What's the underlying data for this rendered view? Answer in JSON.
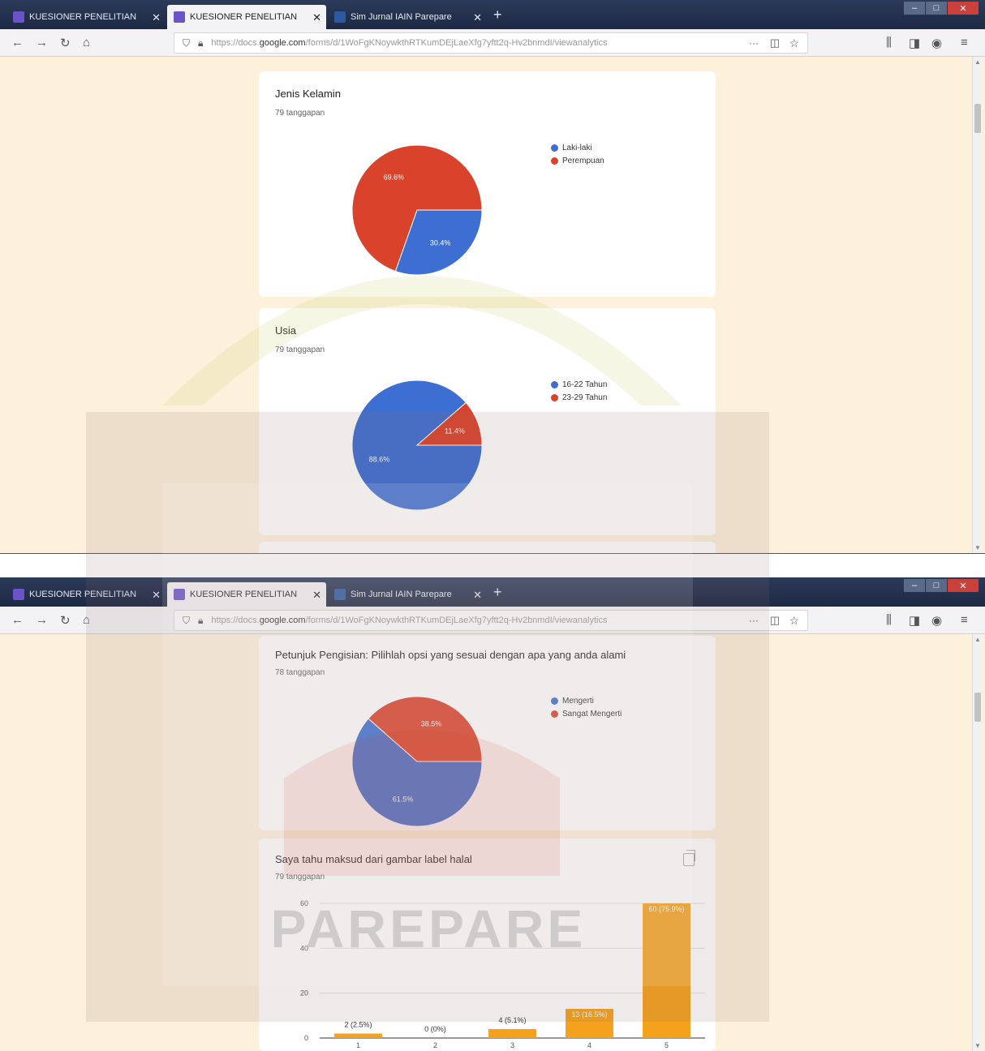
{
  "browser": {
    "tabs": [
      {
        "label": "KUESIONER PENELITIAN",
        "color": "#6b53c8"
      },
      {
        "label": "KUESIONER PENELITIAN",
        "color": "#6b53c8"
      },
      {
        "label": "Sim Jurnal IAIN Parepare",
        "color": "#2c5aa0"
      }
    ],
    "url_prefix": "https://docs.",
    "url_host": "google.com",
    "url_rest": "/forms/d/1WoFgKNoywkthRTKumDEjLaeXfg7yftt2q-Hv2bnmdI/viewanalytics",
    "more": "···",
    "window_buttons": [
      "–",
      "□",
      "✕"
    ]
  },
  "gender_card": {
    "title": "Jenis Kelamin",
    "responses": "79 tanggapan",
    "legend": [
      "Laki-laki",
      "Perempuan"
    ]
  },
  "age_card": {
    "title": "Usia",
    "responses": "79 tanggapan",
    "legend": [
      "16-22 Tahun",
      "23-29 Tahun"
    ]
  },
  "instruction_card": {
    "title": "Petunjuk Pengisian: Pilihlah opsi yang sesuai dengan apa yang anda alami",
    "responses": "78 tanggapan",
    "legend": [
      "Mengerti",
      "Sangat Mengerti"
    ]
  },
  "halal_card": {
    "title": "Saya tahu maksud dari gambar label halal",
    "responses": "79 tanggapan"
  },
  "watermark": {
    "text": "PAREPARE"
  },
  "chart_data": [
    {
      "type": "pie",
      "title": "Jenis Kelamin",
      "categories": [
        "Laki-laki",
        "Perempuan"
      ],
      "values": [
        30.4,
        69.6
      ],
      "labels": [
        "30.4%",
        "69.6%"
      ],
      "colors": [
        "#3c6fd1",
        "#d9432b"
      ]
    },
    {
      "type": "pie",
      "title": "Usia",
      "categories": [
        "16-22 Tahun",
        "23-29 Tahun"
      ],
      "values": [
        88.6,
        11.4
      ],
      "labels": [
        "88.6%",
        "11.4%"
      ],
      "colors": [
        "#3c6fd1",
        "#d9432b"
      ]
    },
    {
      "type": "pie",
      "title": "Petunjuk Pengisian: Pilihlah opsi yang sesuai dengan apa yang anda alami",
      "categories": [
        "Mengerti",
        "Sangat Mengerti"
      ],
      "values": [
        61.5,
        38.5
      ],
      "labels": [
        "61.5%",
        "38.5%"
      ],
      "colors": [
        "#3c6fd1",
        "#d9432b"
      ]
    },
    {
      "type": "bar",
      "title": "Saya tahu maksud dari gambar label halal",
      "categories": [
        "1",
        "2",
        "3",
        "4",
        "5"
      ],
      "values": [
        2,
        0,
        4,
        13,
        60
      ],
      "labels": [
        "2 (2.5%)",
        "0 (0%)",
        "4 (5.1%)",
        "13 (16.5%)",
        "60 (75.9%)"
      ],
      "yticks": [
        0,
        20,
        40,
        60
      ],
      "ylim": [
        0,
        60
      ],
      "color": "#f4a21e"
    }
  ]
}
